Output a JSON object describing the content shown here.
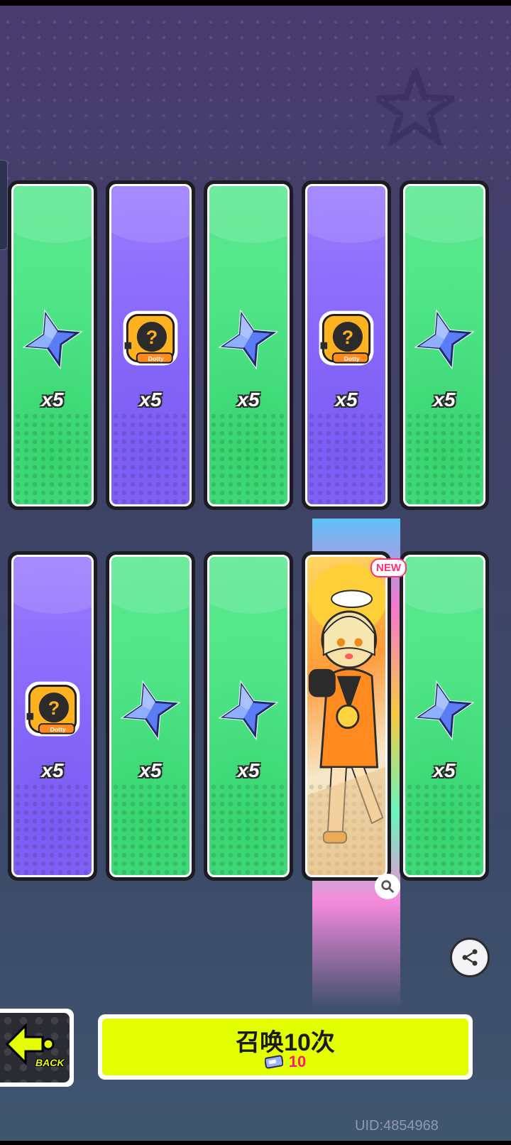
{
  "cards": [
    {
      "type": "crystal",
      "color": "green",
      "quantity": "x5",
      "icon": "star-crystal-icon"
    },
    {
      "type": "dotty-ticket",
      "color": "purple",
      "quantity": "x5",
      "icon": "dotty-mystery-icon"
    },
    {
      "type": "crystal",
      "color": "green",
      "quantity": "x5",
      "icon": "star-crystal-icon"
    },
    {
      "type": "dotty-ticket",
      "color": "purple",
      "quantity": "x5",
      "icon": "dotty-mystery-icon"
    },
    {
      "type": "crystal",
      "color": "green",
      "quantity": "x5",
      "icon": "star-crystal-icon"
    },
    {
      "type": "dotty-ticket",
      "color": "purple",
      "quantity": "x5",
      "icon": "dotty-mystery-icon"
    },
    {
      "type": "crystal",
      "color": "green",
      "quantity": "x5",
      "icon": "star-crystal-icon"
    },
    {
      "type": "crystal",
      "color": "green",
      "quantity": "x5",
      "icon": "star-crystal-icon"
    },
    {
      "type": "character",
      "color": "rainbow",
      "badge": "NEW",
      "icon": "character-portrait"
    },
    {
      "type": "crystal",
      "color": "green",
      "quantity": "x5",
      "icon": "star-crystal-icon"
    }
  ],
  "dotty_label": "Dotty",
  "new_badge": "NEW",
  "back_button": {
    "label": "BACK",
    "icon": "back-arrow-icon"
  },
  "summon_button": {
    "title": "召唤10次",
    "cost": "10",
    "cost_icon": "ticket-icon"
  },
  "share_icon": "share-icon",
  "uid_text": "UID:4854968",
  "colors": {
    "green": "#4fe487",
    "purple": "#8a6bfb",
    "summon": "#e3ff00",
    "cost": "#ff1d6a"
  }
}
